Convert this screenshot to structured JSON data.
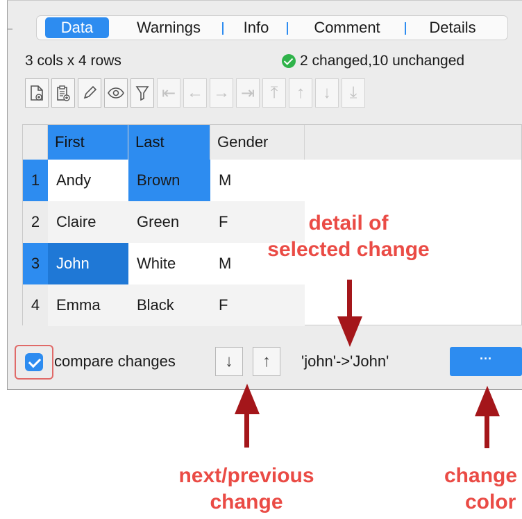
{
  "tabs": [
    {
      "label": "Data",
      "active": true
    },
    {
      "label": "Warnings",
      "active": false
    },
    {
      "label": "Info",
      "active": false
    },
    {
      "label": "Comment",
      "active": false
    },
    {
      "label": "Details",
      "active": false
    }
  ],
  "status": {
    "dimensions": "3 cols x 4 rows",
    "summary": "2 changed,10 unchanged",
    "summary_icon": "check-circle-icon"
  },
  "toolbar": {
    "buttons": [
      {
        "icon": "new-document-icon",
        "enabled": true
      },
      {
        "icon": "paste-document-icon",
        "enabled": true
      },
      {
        "icon": "pencil-icon",
        "enabled": true
      },
      {
        "icon": "eye-icon",
        "enabled": true
      },
      {
        "icon": "filter-icon",
        "enabled": true
      },
      {
        "icon": "move-to-first-column-icon",
        "enabled": false
      },
      {
        "icon": "move-left-icon",
        "enabled": false
      },
      {
        "icon": "move-right-icon",
        "enabled": false
      },
      {
        "icon": "move-to-last-column-icon",
        "enabled": false
      },
      {
        "icon": "move-to-top-icon",
        "enabled": false
      },
      {
        "icon": "move-up-icon",
        "enabled": false
      },
      {
        "icon": "move-down-icon",
        "enabled": false
      },
      {
        "icon": "move-to-bottom-icon",
        "enabled": false
      }
    ]
  },
  "table": {
    "columns": [
      "First",
      "Last",
      "Gender"
    ],
    "rows": [
      {
        "num": "1",
        "cells": [
          "Andy",
          "Brown",
          "M"
        ]
      },
      {
        "num": "2",
        "cells": [
          "Claire",
          "Green",
          "F"
        ]
      },
      {
        "num": "3",
        "cells": [
          "John",
          "White",
          "M"
        ]
      },
      {
        "num": "4",
        "cells": [
          "Emma",
          "Black",
          "F"
        ]
      }
    ],
    "change_color": "#2d8cf0"
  },
  "bottom": {
    "compare_checked": true,
    "compare_label": "compare changes",
    "next_icon": "arrow-down-icon",
    "prev_icon": "arrow-up-icon",
    "change_detail": "'john'->'John'",
    "color_button_label": "···"
  },
  "annotations": {
    "detail_line1": "detail of",
    "detail_line2": "selected change",
    "nav_line1": "next/previous",
    "nav_line2": "change",
    "color_line1": "change",
    "color_line2": "color"
  },
  "colors": {
    "accent": "#2d8cf0",
    "annotation_text": "#ea4b45",
    "annotation_arrow": "#a4161a"
  }
}
